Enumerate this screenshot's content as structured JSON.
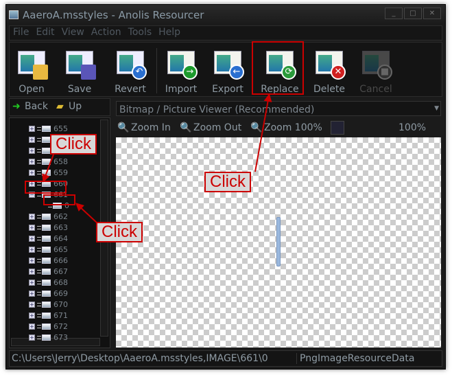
{
  "window": {
    "title": "AaeroA.msstyles - Anolis Resourcer"
  },
  "menu": [
    "File",
    "Edit",
    "View",
    "Action",
    "Tools",
    "Help"
  ],
  "toolbar": {
    "open": "Open",
    "save": "Save",
    "revert": "Revert",
    "import": "Import",
    "export": "Export",
    "replace": "Replace",
    "delete": "Delete",
    "cancel": "Cancel"
  },
  "nav": {
    "back": "Back",
    "up": "Up"
  },
  "tree": {
    "items": [
      "655",
      "656",
      "657",
      "658",
      "659",
      "660",
      "661",
      "0",
      "662",
      "663",
      "664",
      "665",
      "666",
      "667",
      "668",
      "669",
      "670",
      "671",
      "672",
      "673"
    ]
  },
  "viewer": {
    "selected": "Bitmap / Picture Viewer (Recommended)",
    "zoom_in": "Zoom In",
    "zoom_out": "Zoom Out",
    "zoom_100": "Zoom 100%",
    "zoom_level": "100%"
  },
  "status": {
    "path": "C:\\Users\\Jerry\\Desktop\\AaeroA.msstyles,IMAGE\\661\\0",
    "type": "PngImageResourceData"
  },
  "annotations": {
    "callout1": "Click",
    "callout2": "Click",
    "callout3": "Click",
    "color": "#cc0000"
  }
}
